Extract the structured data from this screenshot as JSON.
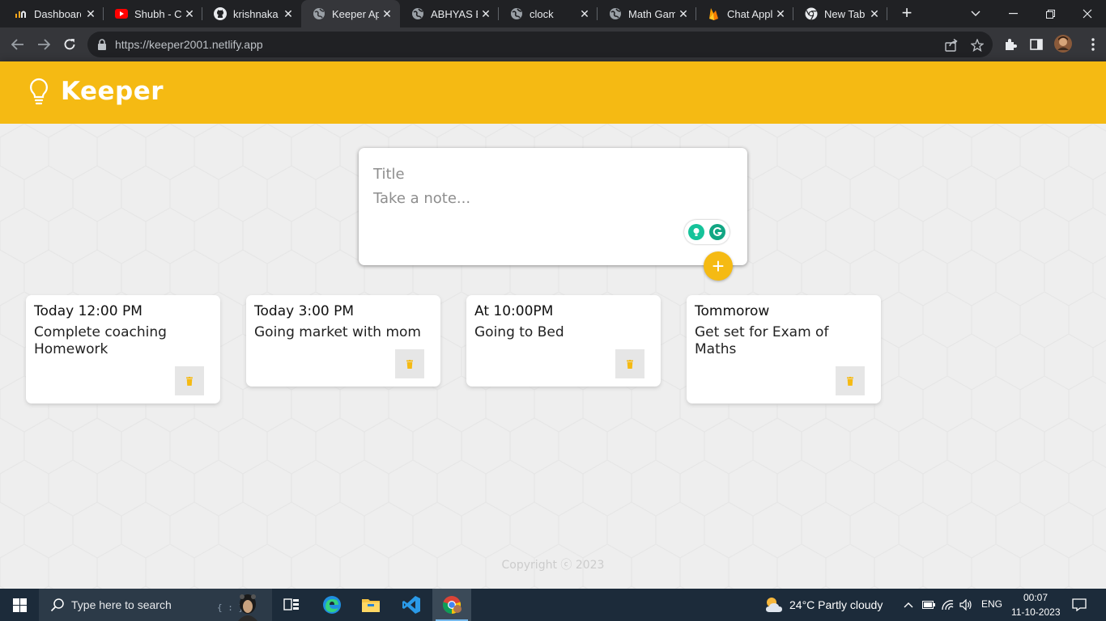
{
  "browser": {
    "tabs": [
      {
        "title": "Dashboard",
        "icon": "dashboard-favicon",
        "active": false
      },
      {
        "title": "Shubh - C",
        "icon": "youtube-icon",
        "active": false
      },
      {
        "title": "krishnaka",
        "icon": "github-icon",
        "active": false
      },
      {
        "title": "Keeper Ap",
        "icon": "globe-icon",
        "active": true
      },
      {
        "title": "ABHYAS E",
        "icon": "globe-icon",
        "active": false
      },
      {
        "title": "clock",
        "icon": "globe-icon",
        "active": false
      },
      {
        "title": "Math Gam",
        "icon": "globe-icon",
        "active": false
      },
      {
        "title": "Chat Appl",
        "icon": "firebase-icon",
        "active": false
      },
      {
        "title": "New Tab",
        "icon": "chrome-icon",
        "active": false
      }
    ],
    "new_tab_label": "+",
    "url": "https://keeper2001.netlify.app"
  },
  "app": {
    "name": "Keeper",
    "accent_color": "#f5ba13"
  },
  "compose": {
    "title_placeholder": "Title",
    "content_placeholder": "Take a note...",
    "add_label": "+"
  },
  "notes": [
    {
      "title": "Today 12:00 PM",
      "content": "Complete coaching Homework"
    },
    {
      "title": "Today 3:00 PM",
      "content": "Going market with mom"
    },
    {
      "title": "At 10:00PM",
      "content": "Going to Bed"
    },
    {
      "title": "Tommorow",
      "content": "Get set for Exam of Maths"
    }
  ],
  "footer": {
    "copyright": "Copyright ⓒ 2023"
  },
  "taskbar": {
    "search_placeholder": "Type here to search",
    "weather": "24°C  Partly cloudy",
    "language": "ENG",
    "time": "00:07",
    "date": "11-10-2023"
  }
}
